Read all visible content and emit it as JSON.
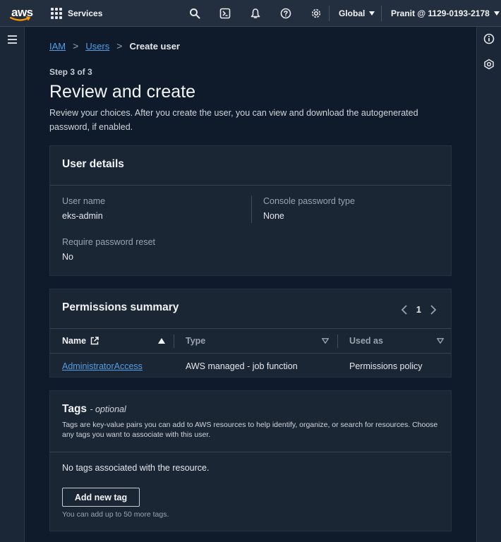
{
  "topbar": {
    "logo_text": "aws",
    "services_label": "Services",
    "region": "Global",
    "account": "Pranit @ 1129-0193-2178",
    "icons": [
      "search-icon",
      "cloudshell-icon",
      "notifications-icon",
      "help-icon",
      "settings-icon"
    ]
  },
  "breadcrumb": {
    "items": [
      "IAM",
      "Users"
    ],
    "current": "Create user",
    "separator": ">"
  },
  "page": {
    "step": "Step 3 of 3",
    "title": "Review and create",
    "description": "Review your choices. After you create the user, you can view and download the autogenerated password, if enabled."
  },
  "user_details": {
    "title": "User details",
    "user_name_label": "User name",
    "user_name_value": "eks-admin",
    "console_password_type_label": "Console password type",
    "console_password_type_value": "None",
    "require_reset_label": "Require password reset",
    "require_reset_value": "No"
  },
  "permissions": {
    "title": "Permissions summary",
    "page": "1",
    "columns": [
      "Name",
      "Type",
      "Used as"
    ],
    "rows": [
      {
        "name": "AdministratorAccess",
        "type": "AWS managed - job function",
        "used_as": "Permissions policy"
      }
    ]
  },
  "tags": {
    "title": "Tags",
    "optional": "- optional",
    "description": "Tags are key-value pairs you can add to AWS resources to help identify, organize, or search for resources. Choose any tags you want to associate with this user.",
    "empty_message": "No tags associated with the resource.",
    "add_button": "Add new tag",
    "hint": "You can add up to 50 more tags."
  },
  "colors": {
    "background": "#0f1b2a",
    "panel": "#1b2635",
    "topbar": "#232f3e",
    "link": "#539fe5"
  }
}
